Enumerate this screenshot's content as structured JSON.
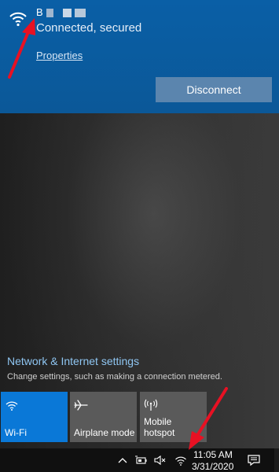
{
  "network": {
    "name": "B",
    "status": "Connected, secured",
    "properties_label": "Properties",
    "disconnect_label": "Disconnect"
  },
  "settings": {
    "title": "Network & Internet settings",
    "subtitle": "Change settings, such as making a connection metered."
  },
  "quick_actions": [
    {
      "label": "Wi-Fi",
      "icon": "wifi-icon",
      "active": true
    },
    {
      "label": "Airplane mode",
      "icon": "airplane-icon",
      "active": false
    },
    {
      "label": "Mobile\nhotspot",
      "icon": "hotspot-icon",
      "active": false
    }
  ],
  "taskbar": {
    "time": "11:05 AM",
    "date": "3/31/2020",
    "icons": [
      "chevron-up-icon",
      "battery-icon",
      "volume-muted-icon",
      "wifi-icon",
      "notification-icon"
    ]
  },
  "colors": {
    "card_bg": "#0b5c9e",
    "disconnect_bg": "#5b85ae",
    "tile_active": "#0a78d7",
    "tile_inactive": "#5a5a5a",
    "link": "#8fc6f2",
    "annotation_arrow": "#e81123"
  }
}
